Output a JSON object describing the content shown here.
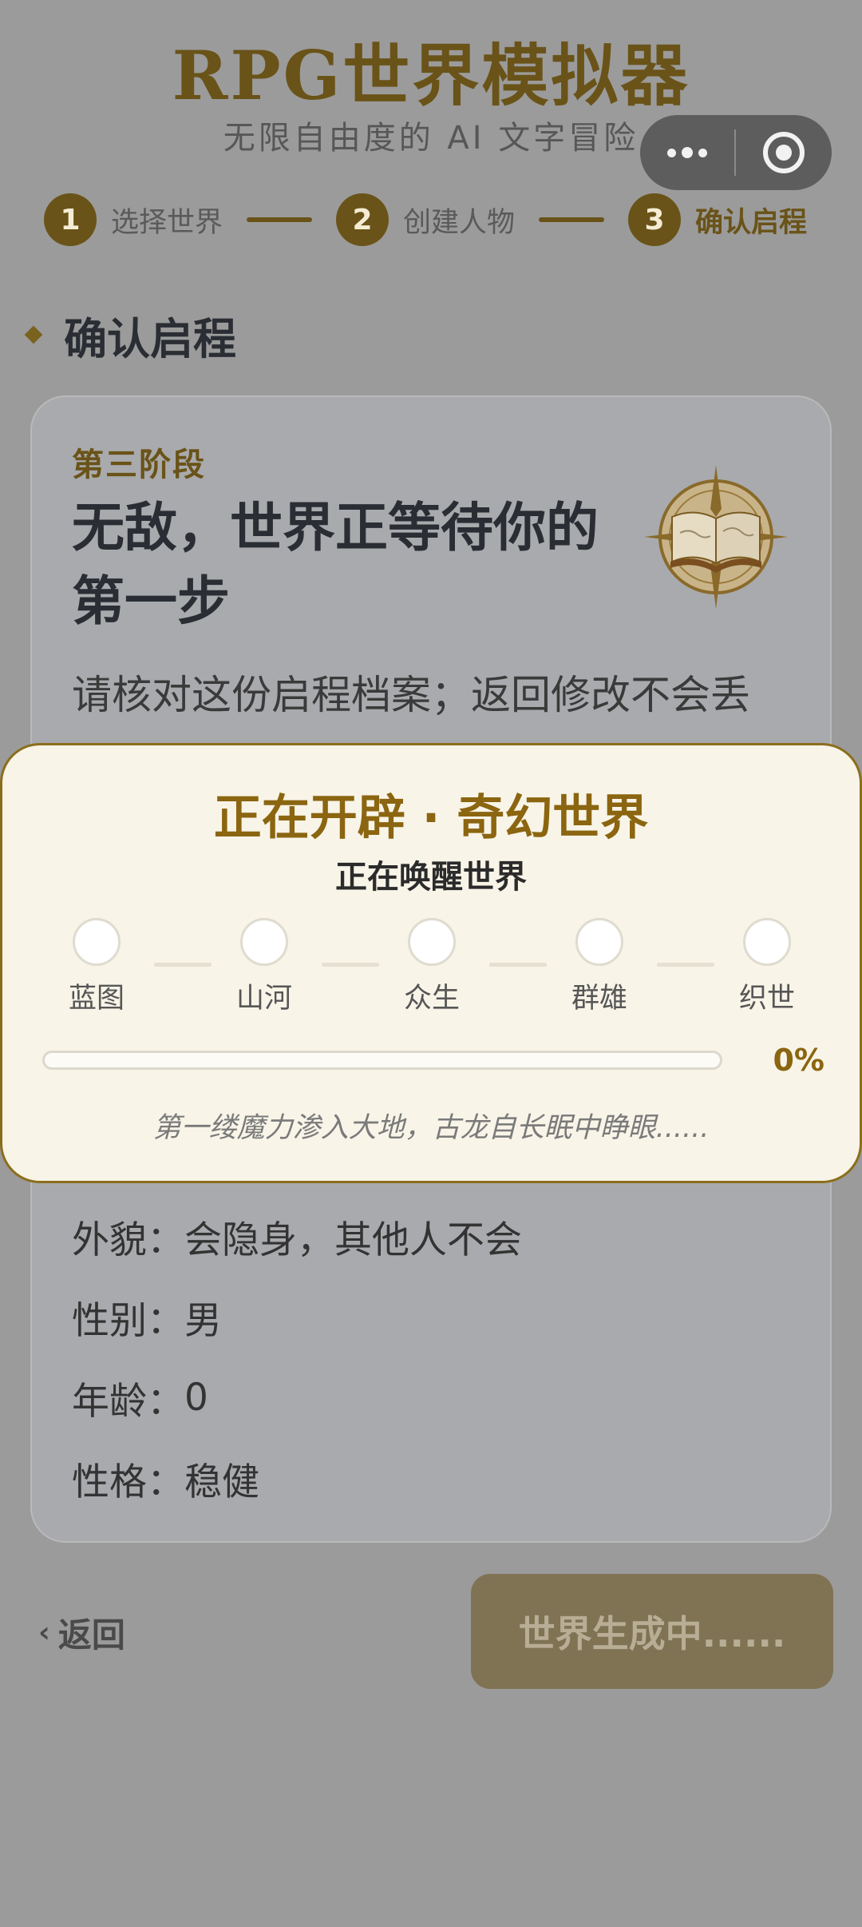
{
  "header": {
    "title": "RPG世界模拟器",
    "subtitle": "无限自由度的 AI 文字冒险"
  },
  "steps": [
    {
      "num": "1",
      "label": "选择世界"
    },
    {
      "num": "2",
      "label": "创建人物"
    },
    {
      "num": "3",
      "label": "确认启程"
    }
  ],
  "section": {
    "title": "确认启程"
  },
  "card": {
    "stage": "第三阶段",
    "headline": "无敌，世界正等待你的第一步",
    "description": "请核对这份启程档案；返回修改不会丢",
    "fields": [
      {
        "key": "外貌",
        "value": "会隐身，其他人不会"
      },
      {
        "key": "性别",
        "value": "男"
      },
      {
        "key": "年龄",
        "value": "0"
      },
      {
        "key": "性格",
        "value": "稳健"
      }
    ]
  },
  "actions": {
    "back_label": "返回",
    "generate_label": "世界生成中......"
  },
  "overlay": {
    "title": "正在开辟 · 奇幻世界",
    "status": "正在唤醒世界",
    "phases": [
      "蓝图",
      "山河",
      "众生",
      "群雄",
      "织世"
    ],
    "progress_percent": 0,
    "progress_label": "0%",
    "flavor_text": "第一缕魔力渗入大地，古龙自长眠中睁眼......"
  },
  "colors": {
    "accent": "#8b6510",
    "title_gold": "#6a5318",
    "backdrop": "#9b9b9b",
    "modal_bg": "#f8f4e8"
  },
  "icons": {
    "capsule_more": "more-dots-icon",
    "capsule_close": "target-icon",
    "emblem": "open-book-compass-icon",
    "section_marker": "diamond-icon",
    "back": "chevron-left-icon"
  }
}
